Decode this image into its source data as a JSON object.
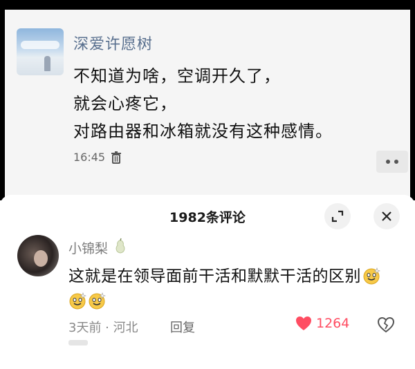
{
  "post": {
    "author": "深爱许愿树",
    "lines": [
      "不知道为啥，空调开久了，",
      "就会心疼它，",
      "对路由器和冰箱就没有这种感情。"
    ],
    "time": "16:45"
  },
  "comments_sheet": {
    "title": "1982条评论",
    "comment": {
      "username": "小锦梨",
      "text": "这就是在领导面前干活和默默干活的区别",
      "meta": "3天前 · 河北",
      "reply_label": "回复",
      "like_count": "1264"
    }
  },
  "colors": {
    "author_blue": "#586f8e",
    "like_red": "#ff4d62",
    "emoji_yellow": "#f7c948"
  }
}
